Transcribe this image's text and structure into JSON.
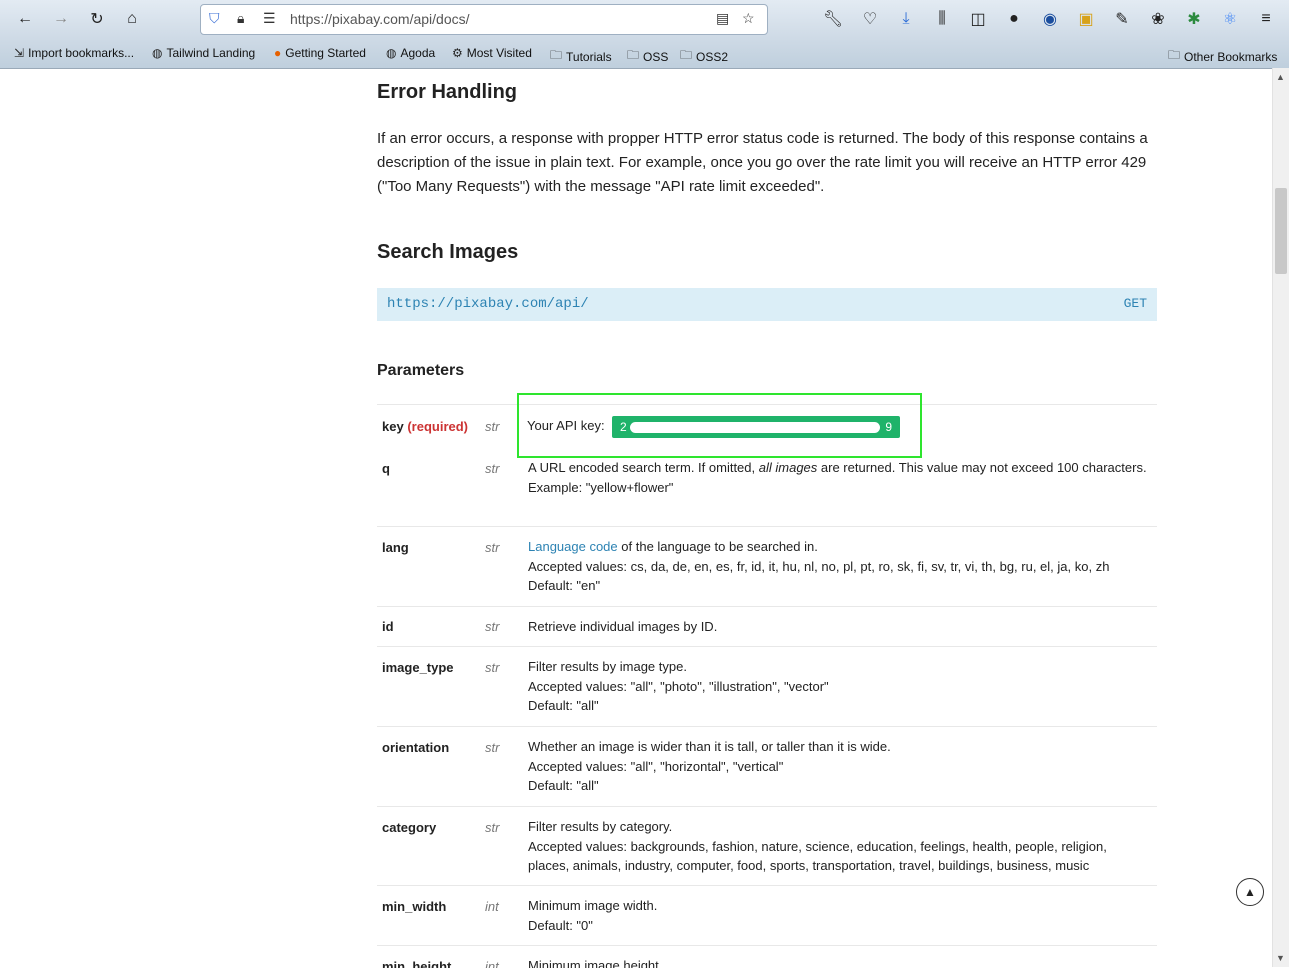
{
  "browser": {
    "url": "https://pixabay.com/api/docs/",
    "bookmarks": [
      {
        "label": "Import bookmarks..."
      },
      {
        "label": "Tailwind Landing"
      },
      {
        "label": "Getting Started"
      },
      {
        "label": "Agoda"
      },
      {
        "label": "Most Visited"
      },
      {
        "label": "Tutorials"
      },
      {
        "label": "OSS"
      },
      {
        "label": "OSS2"
      }
    ],
    "other_bookmarks": "Other Bookmarks"
  },
  "doc": {
    "error_heading": "Error Handling",
    "error_text": "If an error occurs, a response with propper HTTP error status code is returned. The body of this response contains a description of the issue in plain text. For example, once you go over the rate limit you will receive an HTTP error 429 (\"Too Many Requests\") with the message \"API rate limit exceeded\".",
    "search_heading": "Search Images",
    "endpoint_url": "https://pixabay.com/api/",
    "endpoint_method": "GET",
    "params_heading": "Parameters",
    "api_key": {
      "label": "Your API key:",
      "first": "2",
      "last": "9"
    },
    "params": [
      {
        "name": "key",
        "required": "(required)",
        "type": "str"
      },
      {
        "name": "q",
        "type": "str",
        "d1a": "A URL encoded search term. If omitted, ",
        "d1em": "all images",
        "d1b": " are returned. This value may not exceed 100 characters.",
        "d2": "Example: \"yellow+flower\""
      },
      {
        "name": "lang",
        "type": "str",
        "link": "Language code",
        "d1b": " of the language to be searched in.",
        "d2": "Accepted values: cs, da, de, en, es, fr, id, it, hu, nl, no, pl, pt, ro, sk, fi, sv, tr, vi, th, bg, ru, el, ja, ko, zh",
        "d3": "Default: \"en\""
      },
      {
        "name": "id",
        "type": "str",
        "d1": "Retrieve individual images by ID."
      },
      {
        "name": "image_type",
        "type": "str",
        "d1": "Filter results by image type.",
        "d2": "Accepted values: \"all\", \"photo\", \"illustration\", \"vector\"",
        "d3": "Default: \"all\""
      },
      {
        "name": "orientation",
        "type": "str",
        "d1": "Whether an image is wider than it is tall, or taller than it is wide.",
        "d2": "Accepted values: \"all\", \"horizontal\", \"vertical\"",
        "d3": "Default: \"all\""
      },
      {
        "name": "category",
        "type": "str",
        "d1": "Filter results by category.",
        "d2": "Accepted values: backgrounds, fashion, nature, science, education, feelings, health, people, religion, places, animals, industry, computer, food, sports, transportation, travel, buildings, business, music"
      },
      {
        "name": "min_width",
        "type": "int",
        "d1": "Minimum image width.",
        "d2": "Default: \"0\""
      },
      {
        "name": "min_height",
        "type": "int",
        "d1": "Minimum image height."
      }
    ]
  }
}
